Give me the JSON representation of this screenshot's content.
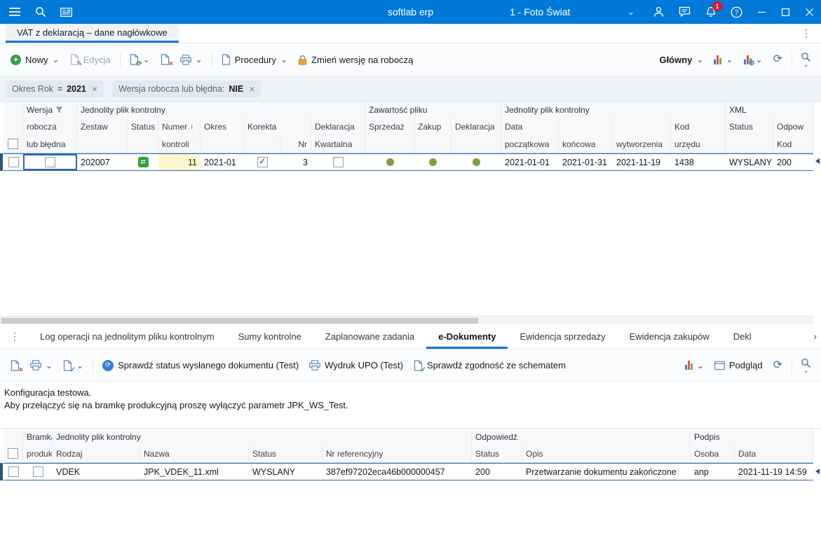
{
  "colors": {
    "titlebar": "#0079d8",
    "accent": "#0078d7",
    "sel": "#2b6cb0",
    "cellyellow": "#fbf7cf",
    "green": "#7aa23d",
    "badge": "#e81123"
  },
  "icons": {
    "chevron_down": "⌄",
    "chevron_right": "›",
    "kebab": "⋮",
    "close": "×",
    "sort_desc": "↓",
    "check": "✓",
    "equals": "=",
    "refresh": "⟳",
    "exchange": "⇄",
    "gear": "⚙",
    "plus": "+",
    "pencil": "✎"
  },
  "titlebar": {
    "app_name": "softlab erp",
    "company": "1 - Foto Świat",
    "badge": "1"
  },
  "tabs": {
    "main": "VAT z deklaracją – dane nagłówkowe"
  },
  "toolbar": {
    "nowy": "Nowy",
    "edycja": "Edycja",
    "procedury": "Procedury",
    "zmien_wersje": "Zmień wersję na roboczą",
    "glowny": "Główny"
  },
  "filters": {
    "chip1": {
      "label": "Okres Rok",
      "value": "2021"
    },
    "chip2": {
      "label": "Wersja robocza lub błędna:",
      "value": "NIE"
    }
  },
  "grid": {
    "groups": {
      "wersja": "Wersja",
      "jpk1": "Jednolity plik kontrolny",
      "zawartosc": "Zawartość pliku",
      "jpk2": "Jednolity plik kontrolny",
      "xml": "XML"
    },
    "h2": {
      "robocza": "robocza",
      "zestaw": "Zestaw",
      "status": "Status",
      "numer": "Numer",
      "okres": "Okres",
      "korekta": "Korekta",
      "deklaracja": "Deklaracja",
      "sprzedaz": "Sprzedaż",
      "zakup": "Zakup",
      "deklaracja2": "Deklaracja",
      "data": "Data",
      "kod": "Kod",
      "xml_status": "Status",
      "odpow": "Odpow"
    },
    "h3": {
      "lub_bledna": "lub błędna",
      "kontroli": "kontroli",
      "nr": "Nr",
      "kwartalna": "Kwartalna",
      "poczatkowa": "początkowa",
      "koncowa": "końcowa",
      "wytworzenia": "wytworzenia",
      "urzedu": "urzędu",
      "kod": "Kod"
    },
    "row": {
      "zestaw": "202007",
      "numer_kontroli": "11",
      "okres": "2021-01",
      "nr": "3",
      "data_poczatkowa": "2021-01-01",
      "data_koncowa": "2021-01-31",
      "data_wytworzenia": "2021-11-19",
      "kod_urzedu": "1438",
      "xml_status": "WYSLANY",
      "odpow_kod": "200"
    }
  },
  "bottom_tabs": {
    "items": [
      {
        "label": "Log operacji na jednolitym pliku kontrolnym"
      },
      {
        "label": "Sumy kontrolne"
      },
      {
        "label": "Zaplanowane zadania"
      },
      {
        "label": "e-Dokumenty"
      },
      {
        "label": "Ewidencja sprzedaży"
      },
      {
        "label": "Ewidencja zakupów"
      },
      {
        "label": "Deklaracje"
      }
    ]
  },
  "toolbar2": {
    "sprawdz_status": "Sprawdź status wysłanego dokumentu (Test)",
    "wydruk_upo": "Wydruk UPO (Test)",
    "sprawdz_zgodnosc": "Sprawdź zgodność ze schematem",
    "podglad": "Podgląd"
  },
  "info": {
    "line1": "Konfiguracja testowa.",
    "line2": "Aby przełączyć się na bramkę produkcyjną proszę wyłączyć parametr JPK_WS_Test."
  },
  "doc_grid": {
    "groups": {
      "bramka": "Bramka",
      "jpk": "Jednolity plik kontrolny",
      "odpowiedz": "Odpowiedź",
      "podpis": "Podpis"
    },
    "headers": {
      "produk": "produk.",
      "rodzaj": "Rodzaj",
      "nazwa": "Nazwa",
      "status": "Status",
      "nr_ref": "Nr referencyjny",
      "odp_status": "Status",
      "opis": "Opis",
      "osoba": "Osoba",
      "data": "Data"
    },
    "row": {
      "rodzaj": "VDEK",
      "nazwa": "JPK_VDEK_11.xml",
      "status": "WYSLANY",
      "nr_ref": "387ef97202eca46b000000457",
      "odp_status": "200",
      "opis": "Przetwarzanie dokumentu zakończone",
      "osoba": "anp",
      "data": "2021-11-19 14:59"
    }
  }
}
